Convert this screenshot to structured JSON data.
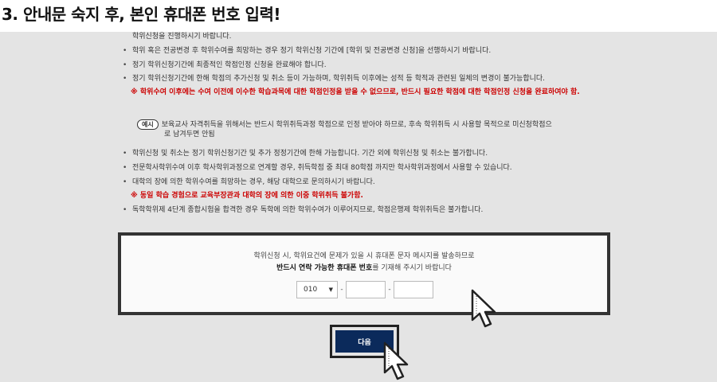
{
  "step_title": "3. 안내문 숙지 후, 본인 휴대폰 번호 입력!",
  "notice": {
    "first_line": "학위신청을 진행하시기 바랍니다.",
    "bullets": [
      "학위 혹은 전공변경 후 학위수여를 희망하는 경우 정기 학위신청 기간에 [학위 및 전공변경 신청]을 선행하시기 바랍니다.",
      "정기 학위신청기간에 최종적인 학점인정 신청을 완료해야 합니다.",
      "정기 학위신청기간에 한해 학점의 추가신청 및 취소 등이 가능하며, 학위취득 이후에는 성적 등 학적과 관련된 일체의 변경이 불가능합니다.",
      "학위신청 및 취소는 정기 학위신청기간 및 추가 정정기간에 한해 가능합니다. 기간 외에 학위신청 및 취소는 불가합니다.",
      "전문학사학위수여 이후 학사학위과정으로 연계할 경우, 취득학점 중 최대 80학점 까지만 학사학위과정에서 사용할 수 있습니다.",
      "대학의 장에 의한 학위수여를 희망하는 경우, 해당 대학으로 문의하시기 바랍니다.",
      "독학학위제 4단계 종합시험을 합격한 경우 독학에 의한 학위수여가 이루어지므로, 학점은행제 학위취득은 불가합니다."
    ],
    "warning1": "※ 학위수여 이후에는 수여 이전에 이수한 학습과목에 대한 학점인정을 받을 수 없으므로, 반드시 필요한 학점에 대한 학점인정 신청을 완료하여야 함.",
    "example_label": "예시",
    "example_text1": "보육교사 자격취득을 위해서는 반드시 학위취득과정 학점으로 인정 받아야 하므로, 후속 학위취득 시 사용할 목적으로 미신청학점으",
    "example_text2": "로 남겨두면 안됨",
    "warning2": "※ 동일 학습 경험으로 교육부장관과 대학의 장에 의한 이중 학위취득 불가함."
  },
  "phone_box": {
    "line1": "학위신청 시, 학위요건에 문제가 있을 시 휴대폰 문자 메시지를 발송하므로",
    "line2_bold": "반드시 연락 가능한 휴대폰 번호",
    "line2_rest": "를 기재해 주시기 바랍니다",
    "prefix_value": "010",
    "prefix_options": [
      "010"
    ],
    "dash": "-",
    "middle_value": "",
    "last_value": ""
  },
  "next_button": {
    "label": "다음"
  },
  "colors": {
    "background": "#e4e4e4",
    "warning": "#cc0000",
    "button": "#0b2a5b",
    "highlight_border": "#333333"
  },
  "icons": {
    "cursor": "pointer-cursor-icon"
  }
}
